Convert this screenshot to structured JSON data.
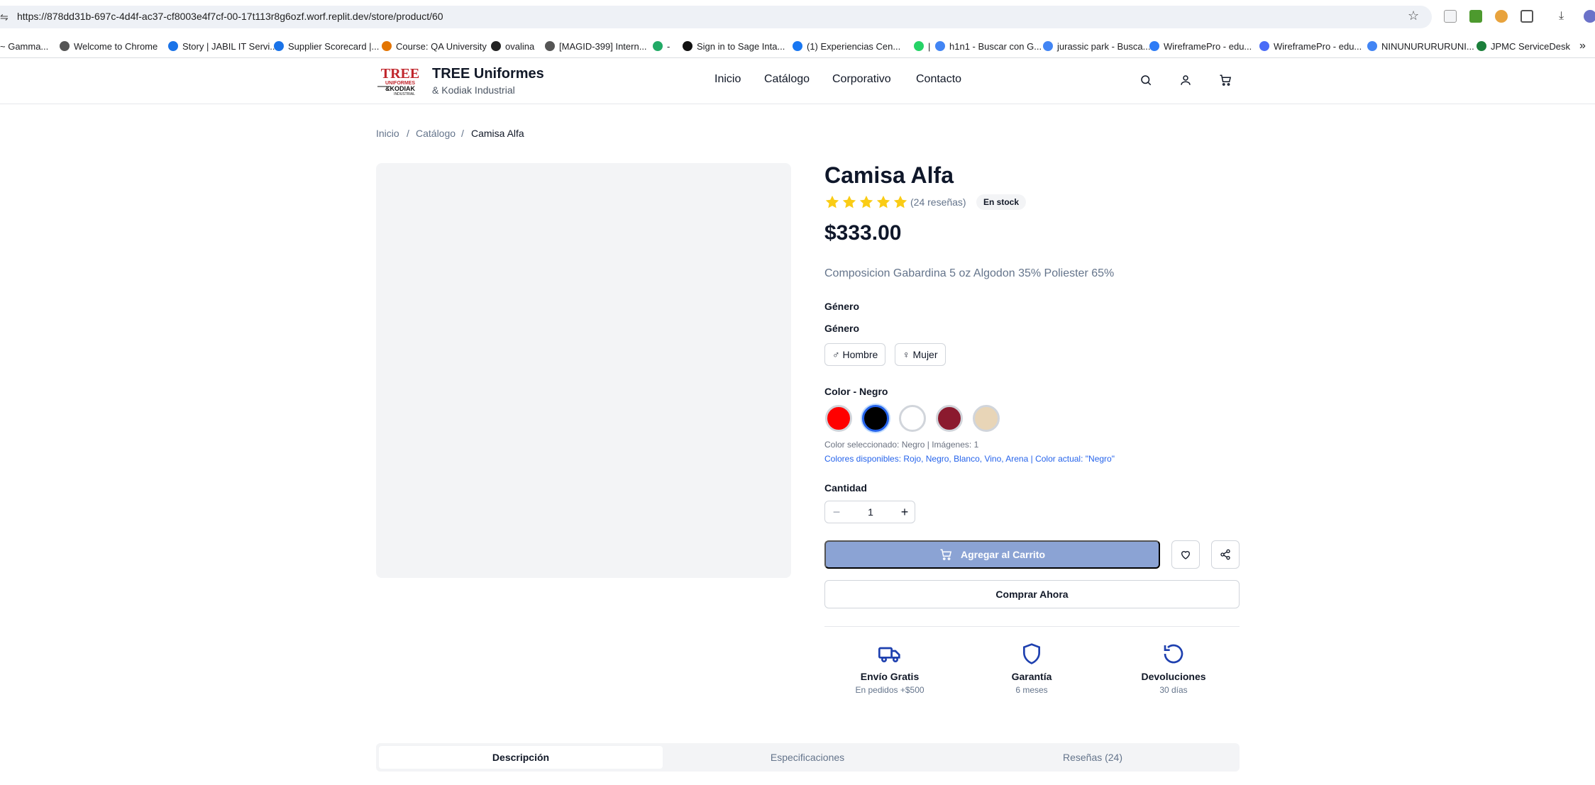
{
  "browser": {
    "url": "https://878dd31b-697c-4d4f-ac37-cf8003e4f7cf-00-17t113r8g6ozf.worf.replit.dev/store/product/60",
    "bookmarks": [
      "~ Gamma...",
      "Welcome to Chrome",
      "Story | JABIL IT Servi...",
      "Supplier Scorecard |...",
      "Course: QA University",
      "ovalina",
      "[MAGID-399] Intern...",
      "-",
      "Sign in to Sage Inta...",
      "(1) Experiencias Cen...",
      "|",
      "h1n1 - Buscar con G...",
      "jurassic park - Busca...",
      "WireframePro - edu...",
      "WireframePro - edu...",
      "NINUNURURURUNI...",
      "JPMC ServiceDesk"
    ],
    "more_label": "»"
  },
  "header": {
    "logo_text_top": "TREE",
    "logo_text_mid": "UNIFORMES",
    "logo_text_bot": "&KODIAK",
    "logo_text_small": "INDUSTRIAL",
    "brand_title": "TREE Uniformes",
    "brand_subtitle": "& Kodiak Industrial",
    "nav": [
      "Inicio",
      "Catálogo",
      "Corporativo",
      "Contacto"
    ]
  },
  "breadcrumb": {
    "items": [
      "Inicio",
      "Catálogo",
      "Camisa Alfa"
    ],
    "separator": "/"
  },
  "product": {
    "title": "Camisa Alfa",
    "rating": 5,
    "reviews_label": "(24 reseñas)",
    "stock_label": "En stock",
    "price": "$333.00",
    "description": "Composicion Gabardina 5 oz Algodon 35% Poliester 65%",
    "gender_heading_1": "Género",
    "gender_heading_2": "Género",
    "gender_options": [
      {
        "icon": "♂",
        "label": "Hombre"
      },
      {
        "icon": "♀",
        "label": "Mujer"
      }
    ],
    "color_label": "Color - Negro",
    "colors": [
      {
        "name": "Rojo",
        "hex": "#ff0000"
      },
      {
        "name": "Negro",
        "hex": "#000000",
        "selected": true
      },
      {
        "name": "Blanco",
        "hex": "#ffffff"
      },
      {
        "name": "Vino",
        "hex": "#8b1a2e"
      },
      {
        "name": "Arena",
        "hex": "#e8d5b7"
      }
    ],
    "color_selected_note": "Color seleccionado: Negro | Imágenes: 1",
    "colors_available_note": "Colores disponibles: Rojo, Negro, Blanco, Vino, Arena | Color actual: \"Negro\"",
    "quantity_label": "Cantidad",
    "quantity": "1",
    "add_to_cart": "Agregar al Carrito",
    "buy_now": "Comprar Ahora"
  },
  "features": [
    {
      "icon": "truck-icon",
      "title": "Envío Gratis",
      "subtitle": "En pedidos +$500"
    },
    {
      "icon": "shield-icon",
      "title": "Garantía",
      "subtitle": "6 meses"
    },
    {
      "icon": "refresh-icon",
      "title": "Devoluciones",
      "subtitle": "30 días"
    }
  ],
  "tabs": [
    "Descripción",
    "Especificaciones",
    "Reseñas (24)"
  ],
  "colors": {
    "accent": "#2563eb",
    "star": "#facc15",
    "cart_button": "#8ba3d4",
    "icon_blue": "#1e40af"
  }
}
